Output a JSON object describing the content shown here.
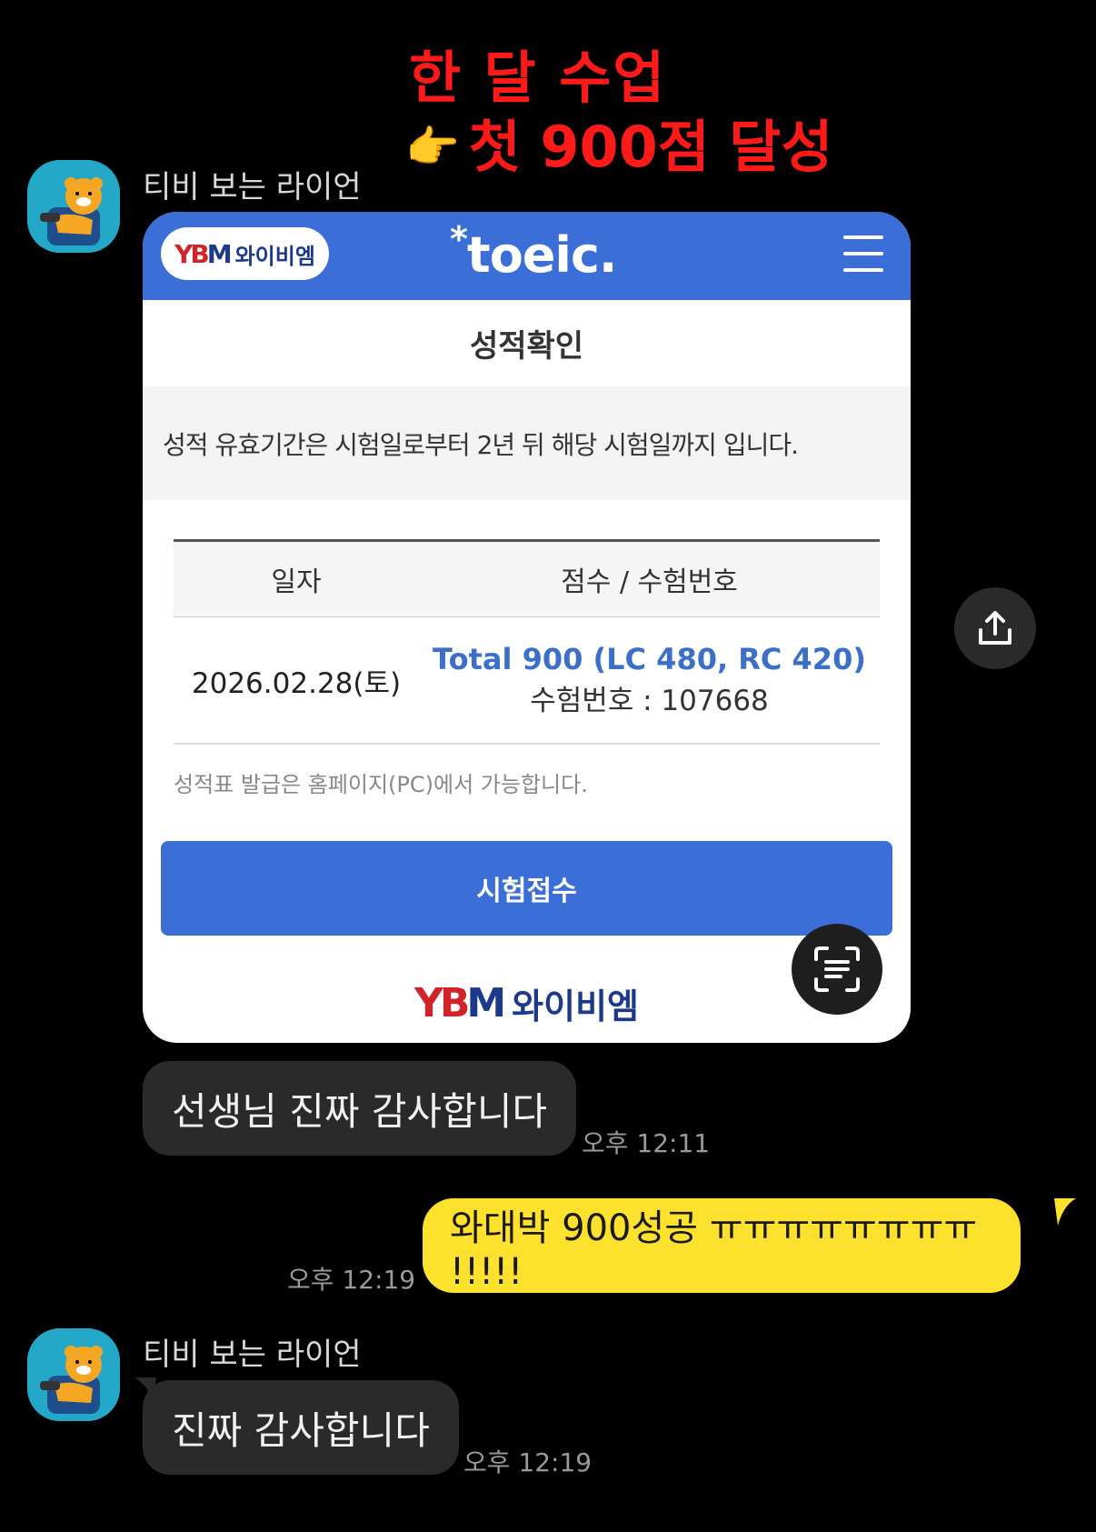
{
  "overlay": {
    "line1": "한 달 수업",
    "pointer": "👉",
    "line2": "첫 900점 달성"
  },
  "messages": [
    {
      "sender": "티비 보는 라이언",
      "type": "image",
      "image": {
        "header": {
          "ybm_mark": "YBM",
          "ybm_name": "와이비엠",
          "toeic_logo": "toeic."
        },
        "title": "성적확인",
        "notice": "성적 유효기간은 시험일로부터 2년 뒤 해당 시험일까지 입니다.",
        "table": {
          "headers": [
            "일자",
            "점수 / 수험번호"
          ],
          "rows": [
            {
              "date": "2026.02.28(토)",
              "total": "Total 900 (LC 480, RC 420)",
              "exam_number": "수험번호 : 107668"
            }
          ]
        },
        "footnote": "성적표 발급은 홈페이지(PC)에서 가능합니다.",
        "apply_button": "시험접수",
        "footer_brand": "와이비엠"
      }
    },
    {
      "sender": "",
      "type": "text",
      "text": "선생님 진짜 감사합니다",
      "time": "오후 12:11"
    },
    {
      "sender": "me",
      "type": "text",
      "text": "와대박 900성공 ㅠㅠㅠㅠㅠㅠㅠㅠ !!!!!",
      "time": "오후 12:19"
    },
    {
      "sender": "티비 보는 라이언",
      "type": "text",
      "text": "진짜 감사합니다",
      "time": "오후 12:19"
    }
  ],
  "icons": {
    "share": "share-icon",
    "scan": "text-scan-icon",
    "avatar": "ryan-avatar"
  },
  "colors": {
    "headline": "#ff1a1a",
    "toeic_blue": "#3b6ed6",
    "score_blue": "#3c6fc7",
    "my_bubble": "#fde12d",
    "their_bubble": "#2a2a2a"
  }
}
